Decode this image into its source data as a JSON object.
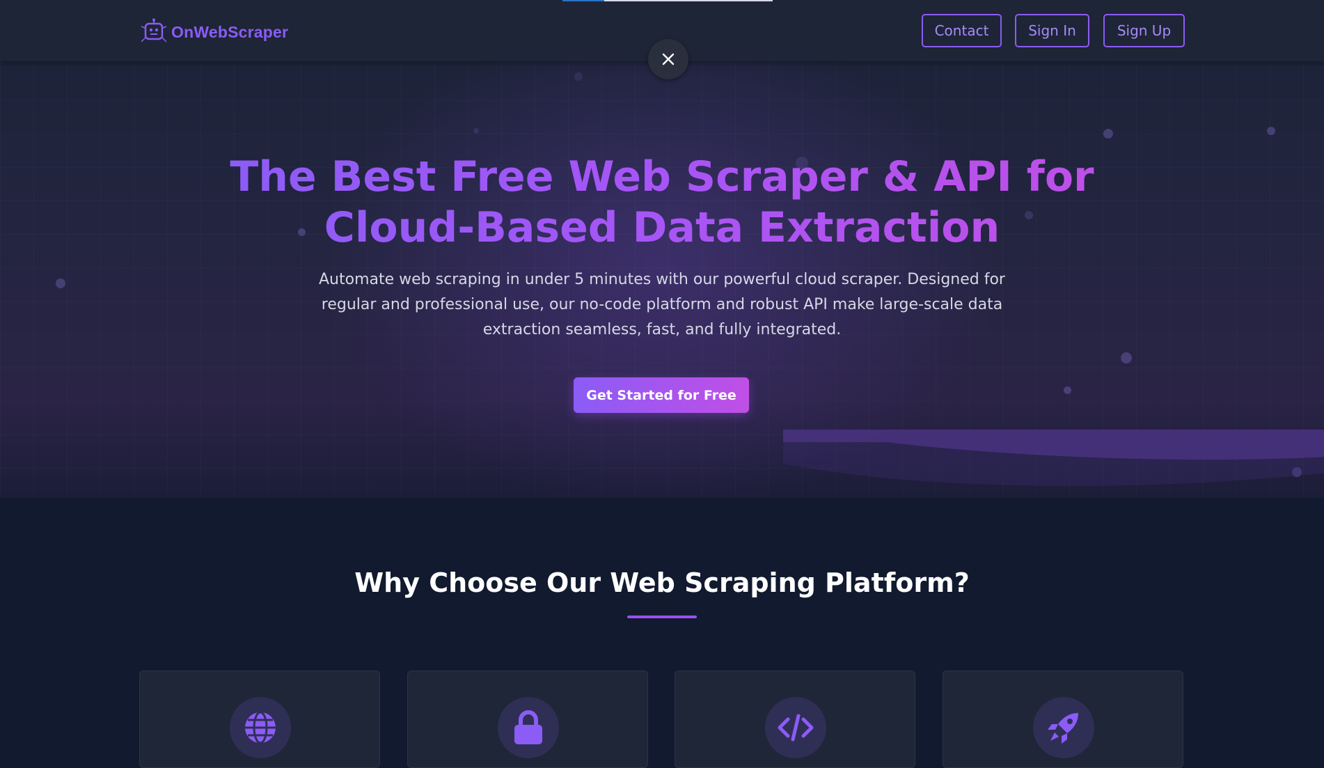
{
  "brand": {
    "name": "OnWebScraper",
    "icon": "robot-logo-icon",
    "accent": "#8b5cf6"
  },
  "nav": {
    "contact_label": "Contact",
    "signin_label": "Sign In",
    "signup_label": "Sign Up"
  },
  "overlay": {
    "close_icon": "close-icon"
  },
  "hero": {
    "title": "The Best Free Web Scraper & API for Cloud-Based Data Extraction",
    "subtitle": "Automate web scraping in under 5 minutes with our powerful cloud scraper. Designed for regular and professional use, our no-code platform and robust API make large-scale data extraction seamless, fast, and fully integrated.",
    "cta_label": "Get Started for Free"
  },
  "features": {
    "title": "Why Choose Our Web Scraping Platform?",
    "cards": [
      {
        "icon": "globe-icon"
      },
      {
        "icon": "lock-icon"
      },
      {
        "icon": "code-icon"
      },
      {
        "icon": "rocket-icon"
      }
    ]
  },
  "colors": {
    "gradient_start": "#8b5cf6",
    "gradient_end": "#c04fe6",
    "background": "#111a2e",
    "navbar": "#1e2536"
  }
}
